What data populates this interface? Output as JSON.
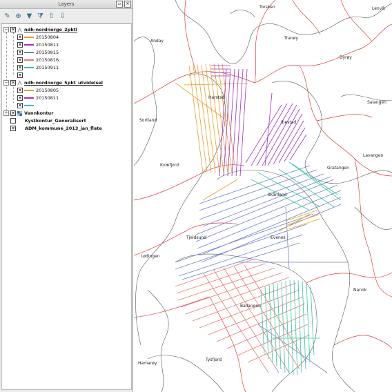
{
  "panel": {
    "title": "Layers",
    "float_icon": "float-icon",
    "close_icon": "close-icon",
    "toolbar": [
      "style-icon",
      "add-group-icon",
      "filter-icon",
      "filter-legend-icon",
      "expand-all-icon",
      "collapse-all-icon"
    ]
  },
  "layers": {
    "group1": {
      "name": "ndh-nordnorge_2pktl",
      "items": [
        {
          "label": "20150804",
          "color": "#e6a020"
        },
        {
          "label": "20150811",
          "color": "#9b30c8"
        },
        {
          "label": "20150815",
          "color": "#6f7fd0"
        },
        {
          "label": "20150816",
          "color": "#e87a70"
        },
        {
          "label": "20150911",
          "color": "#2ec8a4"
        },
        {
          "label": "",
          "color": ""
        }
      ]
    },
    "group2": {
      "name": "ndh-nordnorge_5pkt_utvidelsel",
      "items": [
        {
          "label": "20150805",
          "color": "#e6a020"
        },
        {
          "label": "20150811",
          "color": "#9b30c8"
        },
        {
          "label": "",
          "color": "#2ec8c8"
        }
      ]
    },
    "vannkontur": "Vannkontur",
    "kystkontur": "Kystkontur_Generalisert",
    "adm": "ADM_kommune_2013_jan_flate"
  },
  "map": {
    "place_names": [
      "Torsken",
      "Lenvik",
      "Anday",
      "Tranøy",
      "Dyrøy",
      "Harstad",
      "Salangen",
      "Sortland",
      "Ibestad",
      "Lavangen",
      "Kvæfjord",
      "Gratangen",
      "Skånland",
      "Tjeldsund",
      "Evenes",
      "Lødingen",
      "Narvik",
      "Ballangen",
      "Hamarøy",
      "Tysfjord"
    ]
  }
}
